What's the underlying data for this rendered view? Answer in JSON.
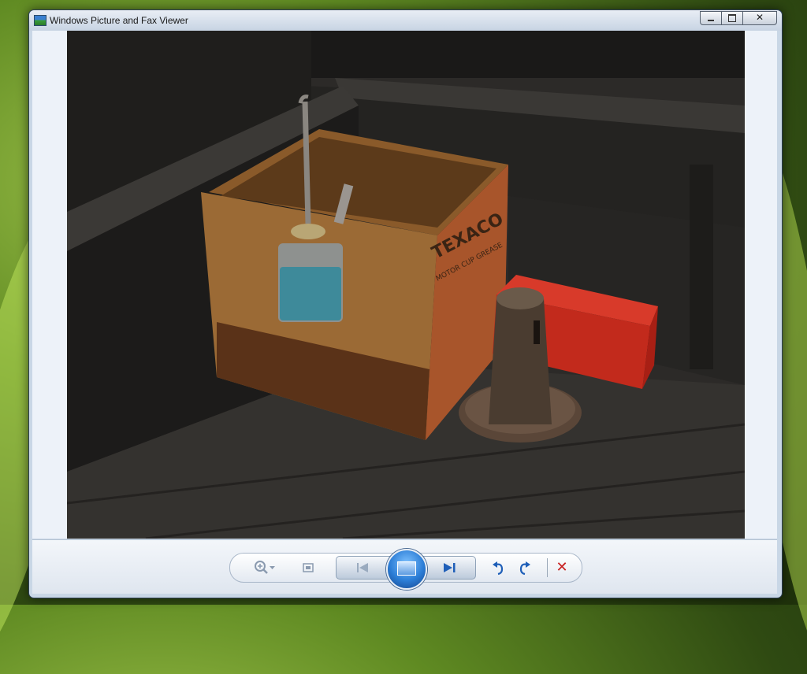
{
  "window": {
    "title": "Windows Picture and Fax Viewer",
    "app_icon": "picture-viewer-icon"
  },
  "caption_buttons": {
    "minimize_icon": "minimize-icon",
    "maximize_icon": "maximize-icon",
    "close_icon": "close-icon",
    "close_glyph": "✕"
  },
  "photo": {
    "description_icon": "photo-image",
    "crate_text": "TEXACO",
    "crate_subtext": "MOTOR CUP GREASE"
  },
  "toolbar": {
    "zoom_icon": "zoom-in-icon",
    "zoom_dropdown_icon": "chevron-down-icon",
    "actual_size_icon": "actual-size-icon",
    "previous_icon": "previous-icon",
    "slideshow_icon": "slideshow-icon",
    "next_icon": "next-icon",
    "rotate_ccw_icon": "rotate-counterclockwise-icon",
    "rotate_cw_icon": "rotate-clockwise-icon",
    "delete_icon": "delete-icon",
    "delete_glyph": "✕"
  },
  "colors": {
    "title_bar_top": "#e9eef5",
    "title_bar_bottom": "#c7d4e3",
    "client_background": "#edf2f9",
    "accent_blue": "#2b7dd6",
    "delete_red": "#c81e1e"
  }
}
